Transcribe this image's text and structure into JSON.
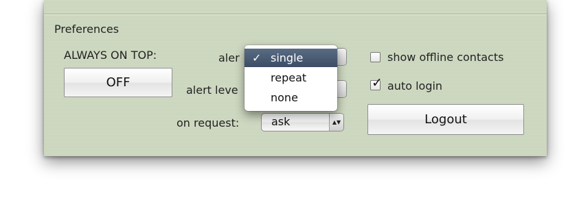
{
  "preferences": {
    "title": "Preferences",
    "always_on_top": {
      "label": "ALWAYS ON TOP:",
      "button_label": "OFF"
    },
    "alert": {
      "label": "alert",
      "label_visible": "aler",
      "menu_items": [
        {
          "label": "single",
          "checked": true,
          "mark": "✓"
        },
        {
          "label": "repeat",
          "checked": false,
          "mark": ""
        },
        {
          "label": "none",
          "checked": false,
          "mark": ""
        }
      ]
    },
    "alert_level": {
      "label_visible": "alert leve"
    },
    "on_request": {
      "label": "on request:",
      "value": "ask",
      "arrows": "▲▼"
    },
    "show_offline_contacts": {
      "label": "show offline contacts",
      "checked": false
    },
    "auto_login": {
      "label": "auto login",
      "checked": true,
      "mark": "✓"
    },
    "logout_label": "Logout"
  }
}
